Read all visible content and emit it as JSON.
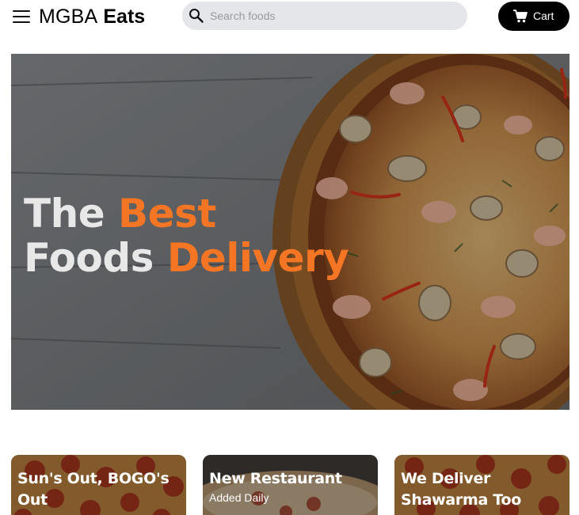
{
  "header": {
    "brand_light": "MGBA",
    "brand_bold": "Eats",
    "search_placeholder": "Search foods",
    "cart_label": "Cart",
    "icons": [
      "menu-icon",
      "search-icon",
      "cart-icon"
    ]
  },
  "hero": {
    "line1_white": "The",
    "line1_accent": "Best",
    "line2_white": "Foods",
    "line2_accent": "Delivery",
    "accent_color": "#f47523"
  },
  "cards": [
    {
      "title": "Sun's Out, BOGO's Out",
      "subtitle": ""
    },
    {
      "title": "New Restaurant",
      "subtitle": "Added Daily"
    },
    {
      "title": "We Deliver Shawarma Too",
      "subtitle": ""
    }
  ]
}
